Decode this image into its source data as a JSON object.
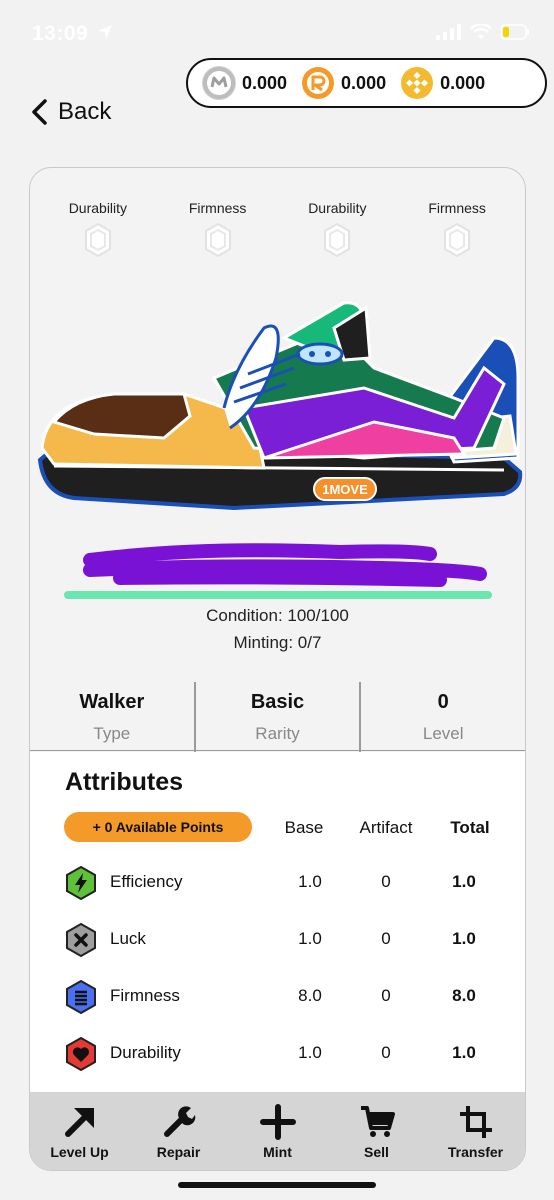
{
  "status_bar": {
    "time": "13:09"
  },
  "wallet": [
    {
      "icon": "move-token-icon",
      "value": "0.000",
      "color": "#c9c9c9"
    },
    {
      "icon": "r-token-icon",
      "value": "0.000",
      "color": "#f39a28"
    },
    {
      "icon": "bnb-token-icon",
      "value": "0.000",
      "color": "#f3ba2f"
    }
  ],
  "nav": {
    "back_label": "Back"
  },
  "sockets": [
    "Durability",
    "Firmness",
    "Durability",
    "Firmness"
  ],
  "sneaker": {
    "brand_badge": "1MOVE"
  },
  "condition": {
    "text": "Condition: 100/100",
    "value": 100,
    "max": 100
  },
  "minting": {
    "text": "Minting: 0/7"
  },
  "stats": [
    {
      "value": "Walker",
      "label": "Type"
    },
    {
      "value": "Basic",
      "label": "Rarity"
    },
    {
      "value": "0",
      "label": "Level"
    }
  ],
  "attributes": {
    "title": "Attributes",
    "points_label": "+ 0 Available Points",
    "columns": {
      "base": "Base",
      "artifact": "Artifact",
      "total": "Total"
    },
    "rows": [
      {
        "name": "Efficiency",
        "base": "1.0",
        "artifact": "0",
        "total": "1.0",
        "icon": "lightning-icon",
        "color": "#5fc13a"
      },
      {
        "name": "Luck",
        "base": "1.0",
        "artifact": "0",
        "total": "1.0",
        "icon": "x-icon",
        "color": "#9e9e9e"
      },
      {
        "name": "Firmness",
        "base": "8.0",
        "artifact": "0",
        "total": "8.0",
        "icon": "list-icon",
        "color": "#4a6ff0"
      },
      {
        "name": "Durability",
        "base": "1.0",
        "artifact": "0",
        "total": "1.0",
        "icon": "heart-icon",
        "color": "#e53935"
      }
    ]
  },
  "actions": [
    {
      "label": "Level Up",
      "icon": "arrow-up-right-icon"
    },
    {
      "label": "Repair",
      "icon": "wrench-icon"
    },
    {
      "label": "Mint",
      "icon": "plus-icon"
    },
    {
      "label": "Sell",
      "icon": "cart-icon"
    },
    {
      "label": "Transfer",
      "icon": "crop-icon"
    }
  ]
}
